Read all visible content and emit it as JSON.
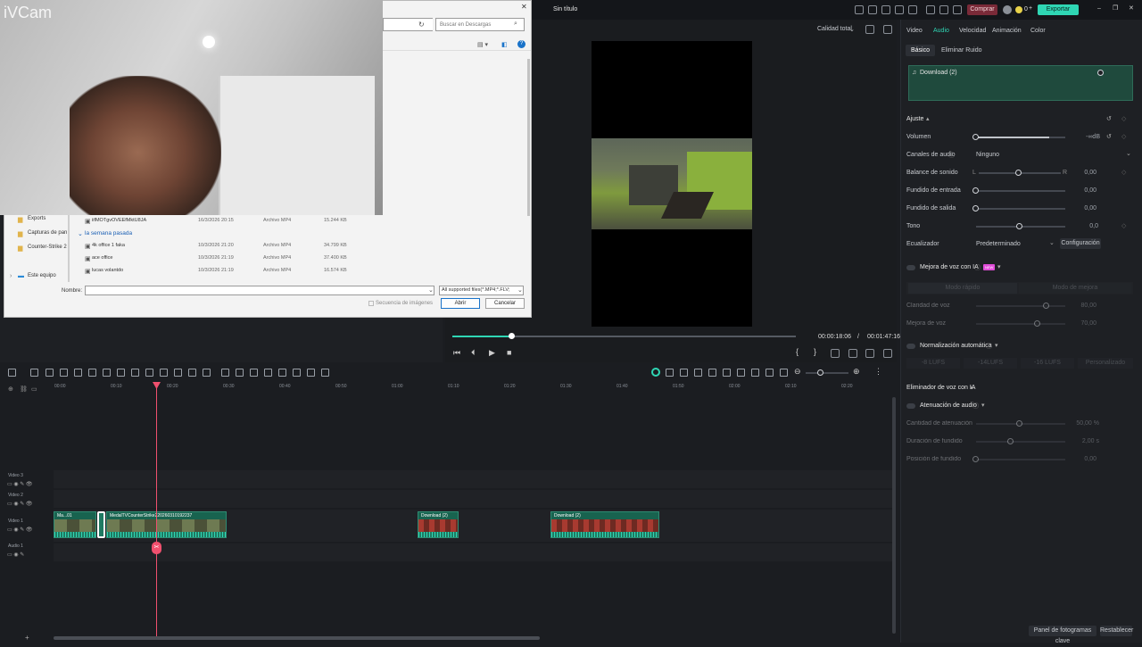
{
  "titlebar": {
    "title": "Sin título",
    "buy_label": "Comprar",
    "export_label": "Exportar",
    "credits": "0"
  },
  "preview": {
    "quality_label": "Calidad total",
    "time_current": "00:00:18:06",
    "time_sep": "/",
    "time_total": "00:01:47:16"
  },
  "right_panel": {
    "tabs": [
      "Video",
      "Audio",
      "Velocidad",
      "Animación",
      "Color"
    ],
    "subtabs": [
      "Básico",
      "Eliminar Ruido"
    ],
    "audio_clip_name": "Download (2)",
    "section_ajuste": "Ajuste",
    "volumen": "Volumen",
    "volumen_value": "-∞dB",
    "canales": "Canales de audio",
    "canales_value": "Ninguno",
    "balance": "Balance de sonido",
    "balance_l": "L",
    "balance_r": "R",
    "balance_value": "0,00",
    "fade_in": "Fundido de entrada",
    "fade_in_value": "0,00",
    "fade_out": "Fundido  de salida",
    "fade_out_value": "0,00",
    "tono": "Tono",
    "tono_value": "0,0",
    "ecualizador": "Ecualizador",
    "ecualizador_value": "Predeterminado",
    "configuracion": "Configuración",
    "mejora_voz": "Mejora de voz con IA",
    "mejora_badge": "NEW",
    "modo_rapido": "Modo rápido",
    "modo_mejora": "Modo de mejora",
    "claridad": "Claridad de voz",
    "claridad_value": "80,00",
    "mejora_voz_row": "Mejora de voz",
    "mejora_voz_value": "70,00",
    "normalizacion": "Normalización automática",
    "norm_btns": [
      "-8 LUFS",
      "-14LUFS",
      "-16 LUFS",
      "Personalizado"
    ],
    "eliminador": "Eliminador de voz con IA",
    "atenuacion": "Atenuación de audio",
    "cantidad_atenuacion": "Cantidad de atenuación",
    "cantidad_value": "50,00 %",
    "duracion_fundido": "Duración de fundido",
    "duracion_value": "2,00 s",
    "posicion_fundido": "Posición de fundido",
    "posicion_value": "0,00",
    "panel_fotogramas": "Panel de fotogramas clave",
    "restablecer": "Restablecer"
  },
  "timeline": {
    "ruler": [
      "00:00",
      "00:10",
      "00:20",
      "00:30",
      "00:40",
      "00:50",
      "01:00",
      "01:10",
      "01:20",
      "01:30",
      "01:40",
      "01:50",
      "02:00",
      "02:10",
      "02:20"
    ],
    "tracks": [
      "Video 3",
      "Video 2",
      "Video 1",
      "Audio 1"
    ],
    "clips": [
      {
        "label": "Ma...01"
      },
      {
        "label": "MedalTVCounterStrike220260310192237"
      },
      {
        "label": "Download (2)"
      },
      {
        "label": "Download (2)"
      }
    ]
  },
  "dialog": {
    "search_placeholder": "Buscar en Descargas",
    "sidebar": [
      "Exports",
      "Capturas de pan",
      "Counter-Strike 2",
      "Este equipo"
    ],
    "group_label": "la semana pasada",
    "files": [
      {
        "name": "iifMOTgvOVEEfMktU8JA",
        "date": "16/3/2026 20:15",
        "type": "Archivo MP4",
        "size": "15.244 KB"
      },
      {
        "name": "4k office 1 faka",
        "date": "10/3/2026 21:20",
        "type": "Archivo MP4",
        "size": "34.799 KB"
      },
      {
        "name": "ace office",
        "date": "10/3/2026 21:19",
        "type": "Archivo MP4",
        "size": "37.400 KB"
      },
      {
        "name": "lucas volantdo",
        "date": "10/3/2026 21:19",
        "type": "Archivo MP4",
        "size": "16.574 KB"
      }
    ],
    "name_label": "Nombre:",
    "name_value": "",
    "filter": "All supported files(*.MP4;*.FLV;",
    "sequence_label": "Secuencia de imágenes",
    "open_label": "Abrir",
    "cancel_label": "Cancelar"
  },
  "webcam": {
    "logo": "iVCam"
  },
  "colors": {
    "accent": "#2fd6b4",
    "playhead": "#f0506e",
    "clip": "#1f7a62"
  }
}
